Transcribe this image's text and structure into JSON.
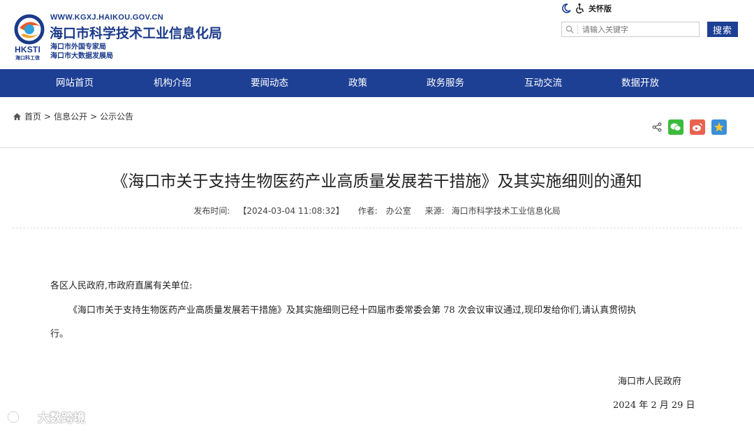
{
  "header": {
    "url": "WWW.KGXJ.HAIKOU.GOV.CN",
    "title": "海口市科学技术工业信息化局",
    "subtitle1": "海口市外国专家局",
    "subtitle2": "海口市大数据发展局",
    "logo_text": "HKSTI",
    "logo_subtext": "海口科工信",
    "care_mode": "关怀版",
    "search_placeholder": "请输入关键字",
    "search_button": "搜索"
  },
  "nav": {
    "items": [
      "网站首页",
      "机构介绍",
      "要闻动态",
      "政策",
      "政务服务",
      "互动交流",
      "数据开放"
    ]
  },
  "breadcrumb": {
    "items": [
      "首页",
      "信息公开",
      "公示公告"
    ],
    "separator": ">"
  },
  "article": {
    "title": "《海口市关于支持生物医药产业高质量发展若干措施》及其实施细则的通知",
    "publish_label": "发布时间:",
    "publish_time": "【2024-03-04 11:08:32】",
    "author_label": "作者:",
    "author": "办公室",
    "source_label": "来源:",
    "source": "海口市科学技术工业信息化局",
    "salutation": "各区人民政府,市政府直属有关单位:",
    "para1_line1": "《海口市关于支持生物医药产业高质量发展若干措施》及其实施细则已经十四届市委常委会第 78 次会议审议通过,现印发给你们,请认真贯彻执",
    "para1_line2": "行。",
    "signature": "海口市人民政府",
    "date": "2024 年 2 月 29 日"
  },
  "watermark": "大数跨境",
  "colors": {
    "brand_blue": "#1d3f94",
    "wechat_green": "#3dbb3d",
    "weibo_red": "#e8624f",
    "qzone_blue": "#3b8fd9"
  }
}
